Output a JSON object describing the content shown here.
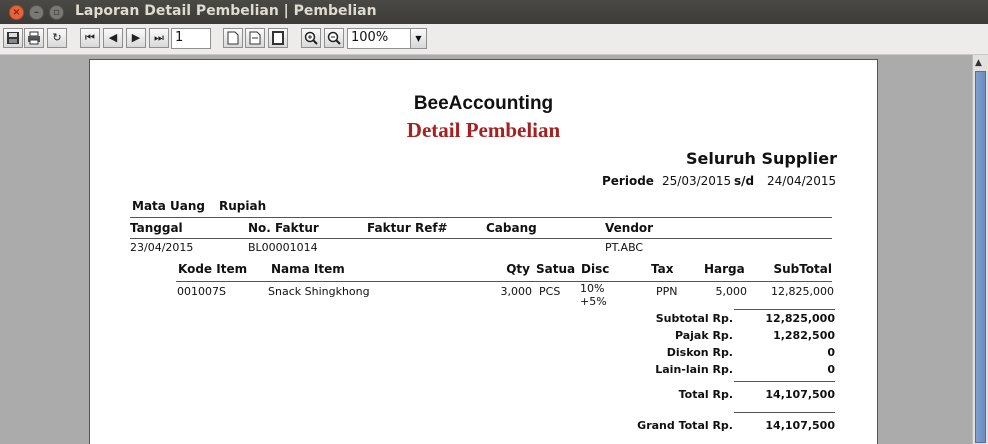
{
  "window": {
    "title": "Laporan Detail Pembelian | Pembelian"
  },
  "toolbar": {
    "page": "1",
    "zoom": "100%"
  },
  "report": {
    "company": "BeeAccounting",
    "title": "Detail Pembelian",
    "supplier_scope": "Seluruh Supplier",
    "periode_label": "Periode",
    "periode_from": "25/03/2015",
    "sd_label": "s/d",
    "periode_to": "24/04/2015",
    "currency_label": "Mata Uang",
    "currency_value": "Rupiah",
    "header": {
      "tanggal": "Tanggal",
      "faktur": "No. Faktur",
      "faktur_ref": "Faktur Ref#",
      "cabang": "Cabang",
      "vendor": "Vendor"
    },
    "invoice": {
      "tanggal": "23/04/2015",
      "faktur": "BL00001014",
      "vendor": "PT.ABC"
    },
    "item_header": {
      "kode": "Kode Item",
      "nama": "Nama Item",
      "qty": "Qty",
      "satuan": "Satua",
      "disc": "Disc",
      "tax": "Tax",
      "harga": "Harga",
      "subtotal": "SubTotal"
    },
    "item": {
      "kode": "001007S",
      "nama": "Snack Shingkhong",
      "qty": "3,000",
      "satuan": "PCS",
      "disc1": "10%",
      "disc2": "+5%",
      "tax": "PPN",
      "harga": "5,000",
      "subtotal": "12,825,000"
    },
    "totals": {
      "subtotal_label": "Subtotal Rp.",
      "subtotal": "12,825,000",
      "pajak_label": "Pajak Rp.",
      "pajak": "1,282,500",
      "diskon_label": "Diskon Rp.",
      "diskon": "0",
      "lain_label": "Lain-lain Rp.",
      "lain": "0",
      "total_label": "Total Rp.",
      "total": "14,107,500",
      "grand_label": "Grand Total Rp.",
      "grand": "14,107,500"
    }
  }
}
